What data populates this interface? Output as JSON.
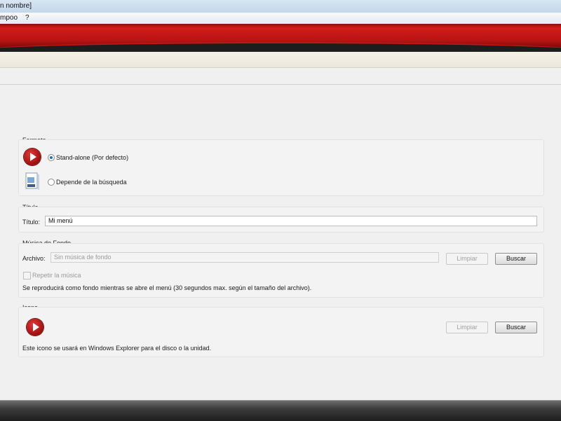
{
  "window": {
    "title": "n nombre]"
  },
  "menu": {
    "items": [
      "mpoo",
      "?"
    ]
  },
  "formato": {
    "label": "Formato",
    "options": [
      {
        "label": "Stand-alone (Por defecto)",
        "checked": true,
        "icon": "play-icon"
      },
      {
        "label": "Depende de la búsqueda",
        "checked": false,
        "icon": "document-icon"
      }
    ]
  },
  "titulo": {
    "label": "Título",
    "field_label": "Título:",
    "value": "Mi menú"
  },
  "musica": {
    "label": "Música de Fondo",
    "field_label": "Archivo:",
    "placeholder": "Sin música de fondo",
    "clear_label": "Limpiar",
    "browse_label": "Buscar",
    "repeat_label": "Repetir la música",
    "note": "Se reproducirá como fondo mientras se abre el menú (30 segundos max. según el tamaño del archivo)."
  },
  "icono": {
    "label": "Icono",
    "clear_label": "Limpiar",
    "browse_label": "Buscar",
    "note": "Este icono se usará en Windows Explorer para el disco o la unidad."
  },
  "colors": {
    "accent": "#c41a1a",
    "banner_dark": "#1d1d1d"
  }
}
